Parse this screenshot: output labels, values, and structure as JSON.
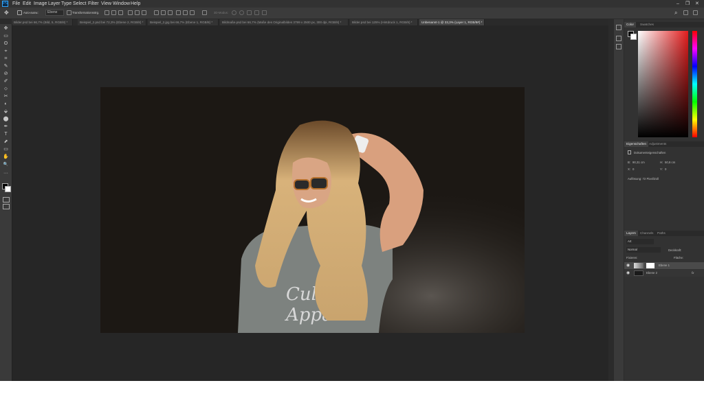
{
  "menu": [
    "File",
    "Edit",
    "Image",
    "Layer",
    "Type",
    "Select",
    "Filter",
    "View",
    "Window",
    "Help"
  ],
  "app_logo": "Ps",
  "window_controls": [
    "–",
    "❐",
    "✕"
  ],
  "options": {
    "auto_select_label": "Auto-ausw.:",
    "auto_select_value": "Ebene",
    "transform_label": "Transformationsstrg.",
    "mode_3d": "3D-Modus:"
  },
  "tabs": [
    "Bilder.psd bei 66,7% (Bild, 5, RGB/8) *",
    "Beispiel_2.psd bei 72,3% (Ebene 2, RGB/8) *",
    "Beispiel_2.jpg bei 66,7% (Ebene 1, RGB/8) *",
    "Bildmaße.psd bei 66,7% (Maße des Originalbildes 3799 x 2500 px, 300 dpi, RGB/8) *",
    "Bilder.psd bei 125% (Hintdruck 1, RGB/8) *",
    "Unbenannt-1 @ 33,3% (Layer 1, RGB/8#) *"
  ],
  "tools": [
    "✥",
    "▭",
    "ʘ",
    "⌖",
    "⌗",
    "✎",
    "⊘",
    "✐",
    "⬦",
    "✂",
    "◐",
    "⬙",
    "⬤",
    "✒",
    "T",
    "⬈",
    "▭",
    "✋",
    "🔍",
    "···"
  ],
  "color_panel": {
    "tabs": [
      "Color",
      "Swatches"
    ]
  },
  "properties_panel": {
    "tabs": [
      "Eigenschaften",
      "Adjustments"
    ],
    "title": "Dokumenteigenschaften",
    "w_label": "B:",
    "w_value": "90,31 cm",
    "h_label": "H:",
    "h_value": "50,8 cm",
    "x_label": "X:",
    "x_value": "0",
    "y_label": "Y:",
    "y_value": "0",
    "resolution": "Auflösung: 72 Pixel/Zoll"
  },
  "layers_panel": {
    "tabs": [
      "Layers",
      "Channels",
      "Paths"
    ],
    "kind": "Art",
    "blend": "Normal",
    "opacity_label": "Deckkraft:",
    "lock_label": "Fixieren:",
    "fill_label": "Fläche:",
    "layers": [
      {
        "name": "Ebene 1"
      },
      {
        "name": "Ebene 2"
      }
    ],
    "fx": "fx"
  },
  "colors": {
    "accent": "#31a8ff",
    "canvas": "#1c1814"
  }
}
